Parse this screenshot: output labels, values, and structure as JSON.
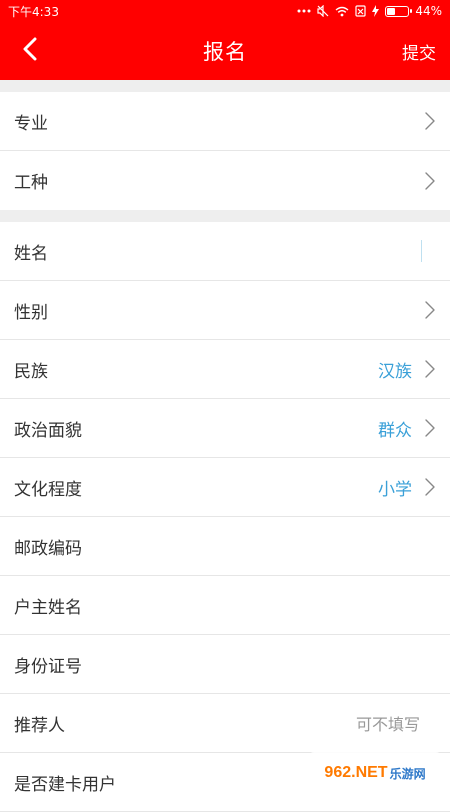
{
  "status_bar": {
    "time": "下午4:33",
    "battery_percent_text": "44%",
    "battery_level": 0.44
  },
  "header": {
    "title": "报名",
    "submit_label": "提交",
    "back_icon": "chevron-left-icon"
  },
  "groups": [
    {
      "rows": [
        {
          "label": "专业",
          "value": "",
          "has_chevron": true
        },
        {
          "label": "工种",
          "value": "",
          "has_chevron": true
        }
      ]
    },
    {
      "rows": [
        {
          "label": "姓名",
          "value": "",
          "has_chevron": false,
          "input": true
        },
        {
          "label": "性别",
          "value": "",
          "has_chevron": true
        },
        {
          "label": "民族",
          "value": "汉族",
          "has_chevron": true
        },
        {
          "label": "政治面貌",
          "value": "群众",
          "has_chevron": true
        },
        {
          "label": "文化程度",
          "value": "小学",
          "has_chevron": true
        },
        {
          "label": "邮政编码",
          "value": "",
          "has_chevron": false
        },
        {
          "label": "户主姓名",
          "value": "",
          "has_chevron": false
        },
        {
          "label": "身份证号",
          "value": "",
          "has_chevron": false
        },
        {
          "label": "推荐人",
          "placeholder": "可不填写",
          "has_chevron": false
        },
        {
          "label": "是否建卡用户",
          "value": "",
          "has_chevron": false
        }
      ]
    }
  ],
  "watermark": {
    "brand": "962.NET",
    "sub": "乐游网"
  },
  "colors": {
    "header_bg": "#ff0000",
    "value_text": "#3aa0d8",
    "separator_bg": "#eeeeee"
  }
}
